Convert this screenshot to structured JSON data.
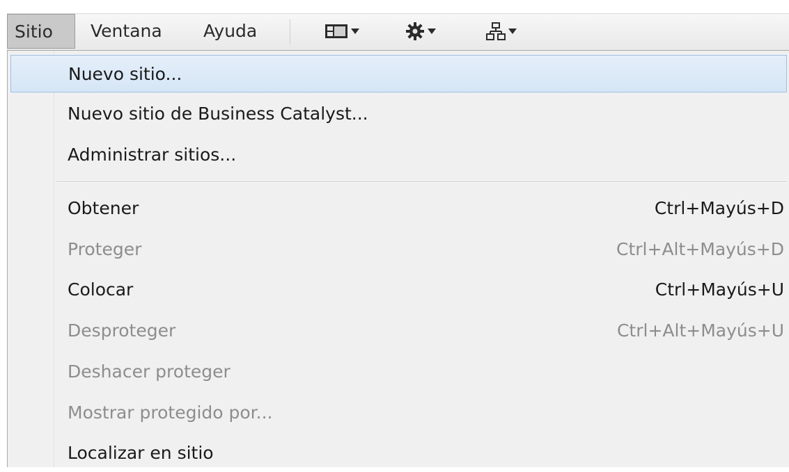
{
  "menubar": {
    "items": [
      {
        "label": "Sitio",
        "active": true
      },
      {
        "label": "Ventana",
        "active": false
      },
      {
        "label": "Ayuda",
        "active": false
      }
    ],
    "tools": [
      {
        "icon": "layout-icon"
      },
      {
        "icon": "gear-icon"
      },
      {
        "icon": "site-structure-icon"
      }
    ]
  },
  "menu": {
    "group1": [
      {
        "label": "Nuevo sitio...",
        "shortcut": "",
        "enabled": true,
        "highlighted": true
      },
      {
        "label": "Nuevo sitio de Business Catalyst...",
        "shortcut": "",
        "enabled": true
      },
      {
        "label": "Administrar sitios...",
        "shortcut": "",
        "enabled": true
      }
    ],
    "group2": [
      {
        "label": "Obtener",
        "shortcut": "Ctrl+Mayús+D",
        "enabled": true
      },
      {
        "label": "Proteger",
        "shortcut": "Ctrl+Alt+Mayús+D",
        "enabled": false
      },
      {
        "label": "Colocar",
        "shortcut": "Ctrl+Mayús+U",
        "enabled": true
      },
      {
        "label": "Desproteger",
        "shortcut": "Ctrl+Alt+Mayús+U",
        "enabled": false
      },
      {
        "label": "Deshacer proteger",
        "shortcut": "",
        "enabled": false
      },
      {
        "label": "Mostrar protegido por...",
        "shortcut": "",
        "enabled": false
      },
      {
        "label": "Localizar en sitio",
        "shortcut": "",
        "enabled": true
      }
    ]
  }
}
